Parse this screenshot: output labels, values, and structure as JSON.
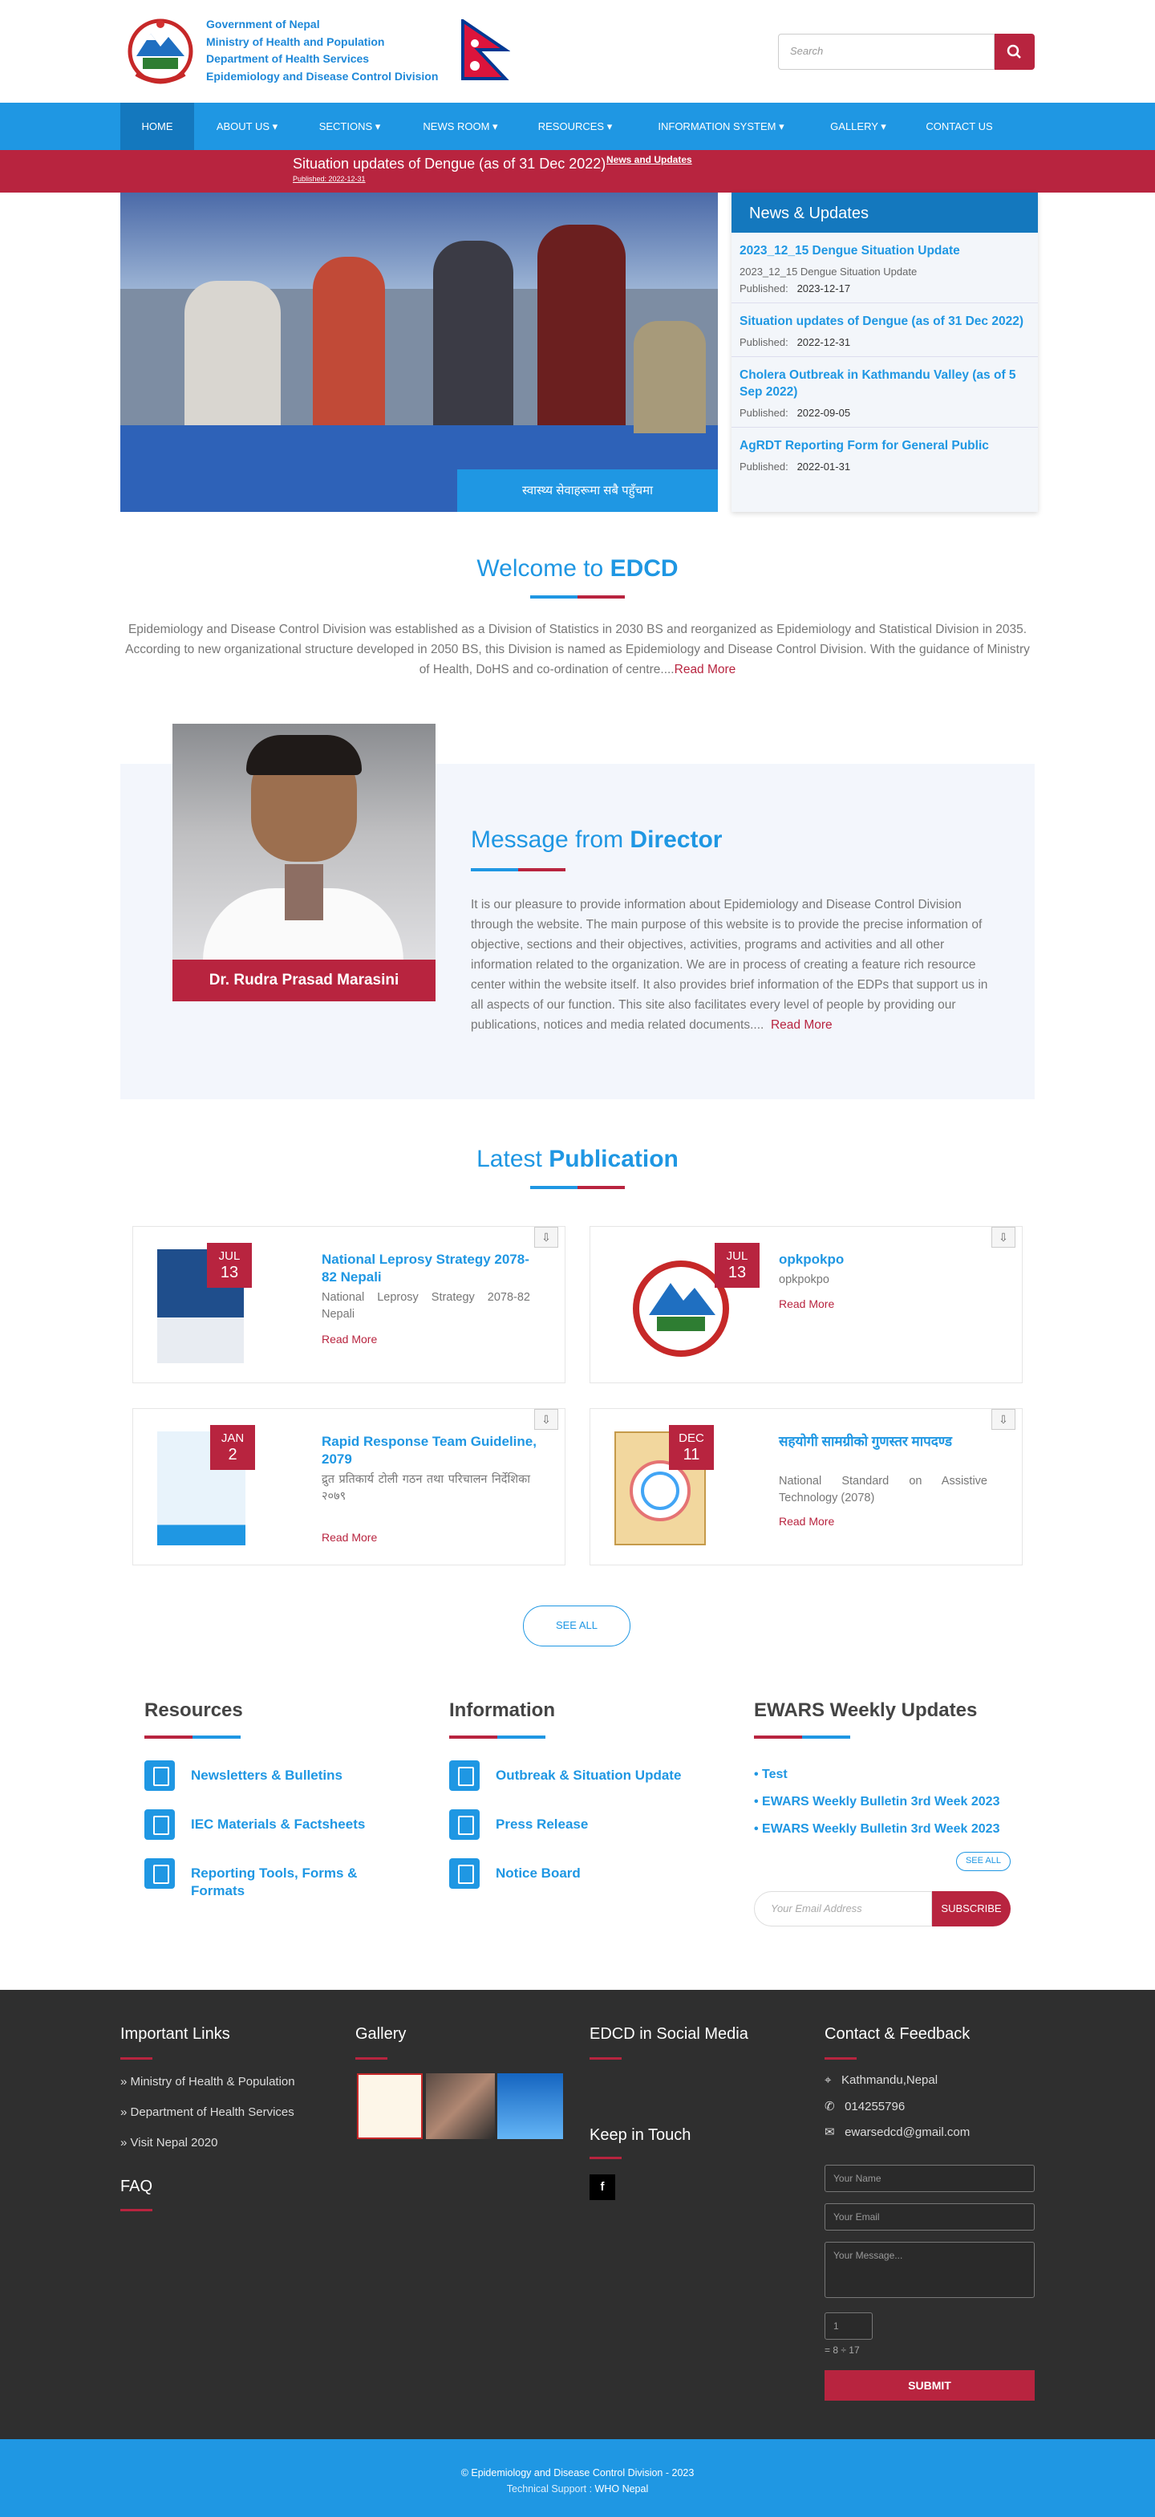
{
  "header": {
    "org_lines": [
      "Government of Nepal",
      "Ministry of Health and Population",
      "Department of Health Services",
      "Epidemiology and Disease Control Division"
    ],
    "search_placeholder": "Search"
  },
  "nav": [
    "HOME",
    "ABOUT US ▾",
    "SECTIONS ▾",
    "NEWS ROOM ▾",
    "RESOURCES ▾",
    "INFORMATION SYSTEM ▾",
    "GALLERY ▾",
    "CONTACT US"
  ],
  "alert": {
    "title": "Situation updates of Dengue (as of 31 Dec 2022)",
    "link": "News and Updates",
    "published": "Published: 2022-12-31"
  },
  "slider_caption": "स्वास्थ्य सेवाहरूमा सबै पहुँचमा",
  "news": {
    "heading": "News & Updates",
    "items": [
      {
        "title": "2023_12_15 Dengue Situation Update",
        "desc": "2023_12_15 Dengue Situation Update",
        "pub_label": "Published:",
        "date": "2023-12-17"
      },
      {
        "title": "Situation updates of Dengue (as of 31 Dec 2022)",
        "desc": "",
        "pub_label": "Published:",
        "date": "2022-12-31"
      },
      {
        "title": "Cholera Outbreak in Kathmandu Valley (as of 5 Sep 2022)",
        "desc": "",
        "pub_label": "Published:",
        "date": "2022-09-05"
      },
      {
        "title": "AgRDT Reporting Form for General Public",
        "desc": "",
        "pub_label": "Published:",
        "date": "2022-01-31"
      }
    ]
  },
  "welcome": {
    "title_pre": "Welcome to ",
    "title_bold": "EDCD",
    "text": "Epidemiology and Disease Control Division was established as a Division of Statistics in 2030 BS and reorganized as Epidemiology and Statistical Division in 2035. According to new organizational structure developed in 2050 BS, this Division is named as Epidemiology and Disease Control Division. With the guidance of Ministry of Health, DoHS and co-ordination of centre....",
    "read_more": "Read More"
  },
  "director": {
    "name": "Dr. Rudra Prasad Marasini",
    "title_pre": "Message from ",
    "title_bold": "Director",
    "text": "It is our pleasure to provide information about Epidemiology and Disease Control Division through the website. The main purpose of this website is to provide the precise information of objective, sections and their objectives, activities, programs and activities and all other information related to the organization. We are in process of creating a feature rich resource center within the website itself. It also provides brief information of the EDPs that support us in all aspects of our function. This site also facilitates every level of people by providing our publications, notices and media related documents....",
    "read_more": "Read More"
  },
  "publications": {
    "title_pre": "Latest ",
    "title_bold": "Publication",
    "items": [
      {
        "month": "JUL",
        "day": "13",
        "title": "National Leprosy Strategy 2078-82 Nepali",
        "desc": "National Leprosy Strategy 2078-82 Nepali",
        "more": "Read More"
      },
      {
        "month": "JUL",
        "day": "13",
        "title": "opkpokpo",
        "desc": "opkpokpo",
        "more": "Read More"
      },
      {
        "month": "JAN",
        "day": "2",
        "title": "Rapid Response Team Guideline, 2079",
        "desc": "द्रुत प्रतिकार्य टोली गठन तथा परिचालन निर्देशिका २०७९",
        "more": "Read More"
      },
      {
        "month": "DEC",
        "day": "11",
        "title": "सहयोगी सामग्रीको गुणस्तर मापदण्ड",
        "desc": "National Standard on Assistive Technology (2078)",
        "more": "Read More"
      }
    ],
    "see_all": "SEE ALL"
  },
  "resources": {
    "title": "Resources",
    "items": [
      "Newsletters & Bulletins",
      "IEC Materials & Factsheets",
      "Reporting Tools, Forms & Formats"
    ]
  },
  "information": {
    "title": "Information",
    "items": [
      "Outbreak & Situation Update",
      "Press Release",
      "Notice Board"
    ]
  },
  "ewars": {
    "title": "EWARS Weekly Updates",
    "items": [
      "Test",
      "EWARS Weekly Bulletin 3rd Week 2023",
      "EWARS Weekly Bulletin 3rd Week 2023"
    ],
    "see_all": "SEE ALL",
    "email_placeholder": "Your Email Address",
    "subscribe": "SUBSCRIBE"
  },
  "footer": {
    "important_title": "Important Links",
    "links": [
      "Ministry of Health & Population",
      "Department of Health Services",
      "Visit Nepal 2020"
    ],
    "faq": "FAQ",
    "gallery_title": "Gallery",
    "social_title": "EDCD in Social Media",
    "keep_title": "Keep in Touch",
    "contact_title": "Contact & Feedback",
    "address": "Kathmandu,Nepal",
    "phone": "014255796",
    "email": "ewarsedcd@gmail.com",
    "name_ph": "Your Name",
    "email_ph": "Your Email",
    "msg_ph": "Your Message...",
    "captcha_value": "1",
    "captcha_q": "= 8 ÷ 17",
    "submit": "SUBMIT",
    "copyright": "© Epidemiology and Disease Control Division - 2023",
    "support_label": "Technical Support :",
    "support_name": "WHO Nepal"
  },
  "colors": {
    "blue": "#1f97e3",
    "dark_blue": "#1478be",
    "red": "#b8243f",
    "footer": "#2f2f2f"
  }
}
